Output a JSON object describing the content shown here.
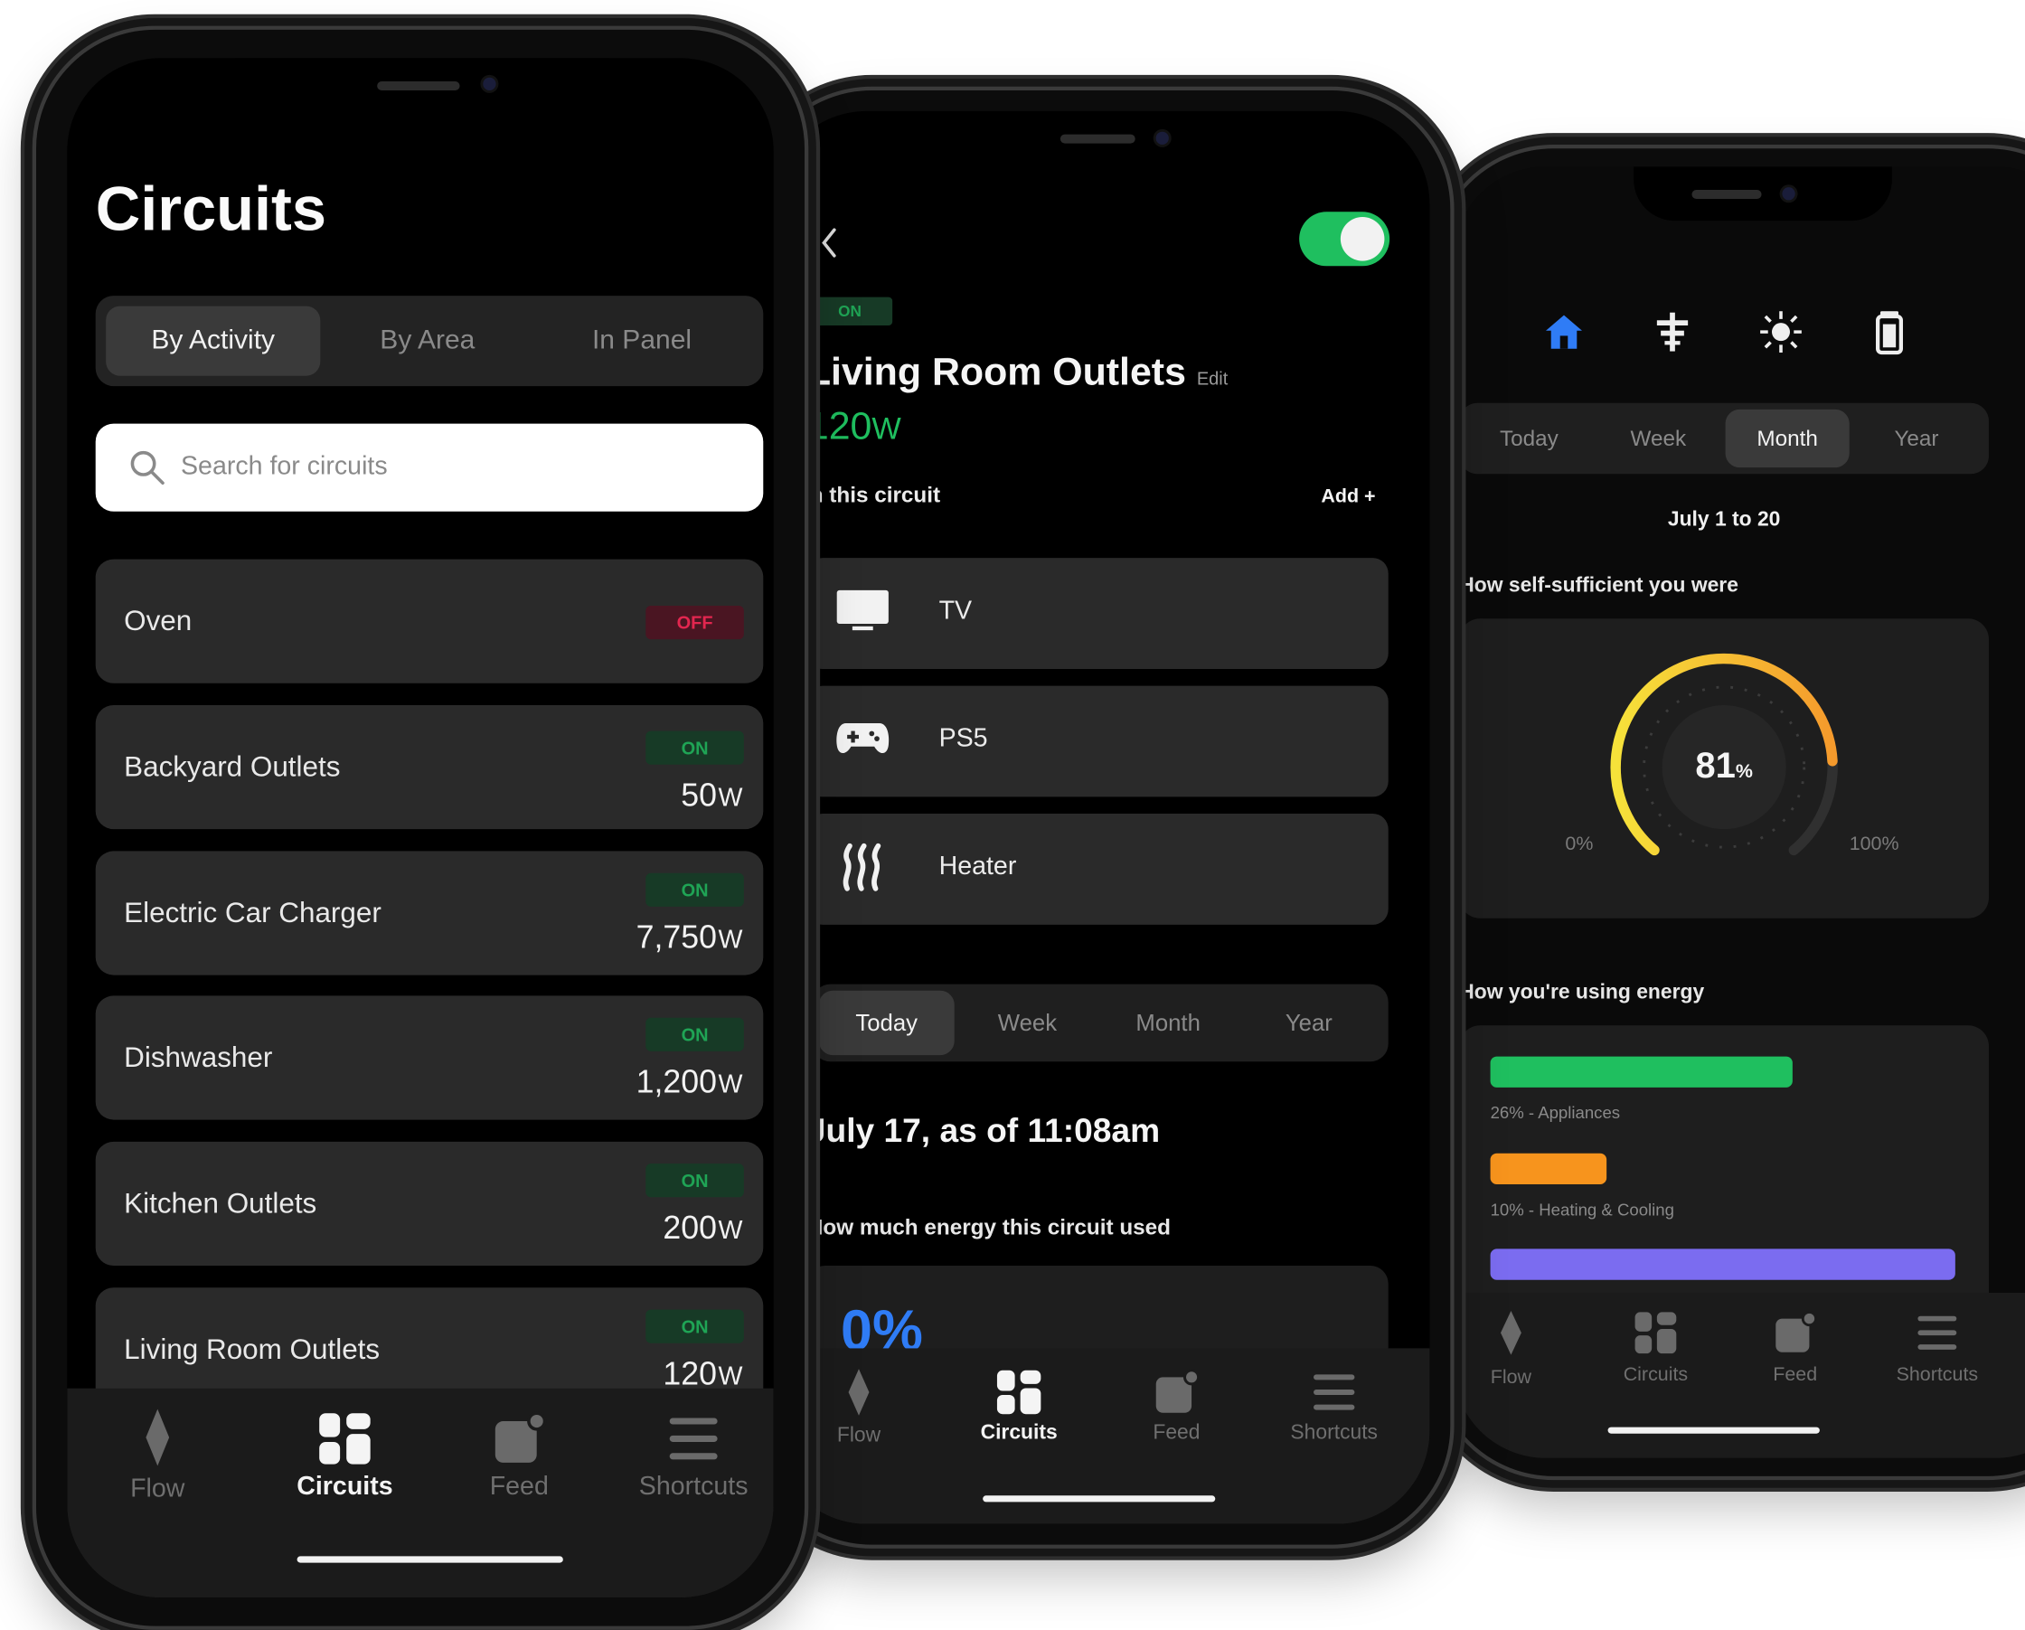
{
  "phone1": {
    "title": "Circuits",
    "segments": [
      "By Activity",
      "By Area",
      "In Panel"
    ],
    "search_placeholder": "Search for circuits",
    "circuits": [
      {
        "name": "Oven",
        "status": "OFF",
        "watts": "",
        "unit": ""
      },
      {
        "name": "Backyard Outlets",
        "status": "ON",
        "watts": "50",
        "unit": "W"
      },
      {
        "name": "Electric Car Charger",
        "status": "ON",
        "watts": "7,750",
        "unit": "W"
      },
      {
        "name": "Dishwasher",
        "status": "ON",
        "watts": "1,200",
        "unit": "W"
      },
      {
        "name": "Kitchen Outlets",
        "status": "ON",
        "watts": "200",
        "unit": "W"
      },
      {
        "name": "Living Room Outlets",
        "status": "ON",
        "watts": "120",
        "unit": "W"
      }
    ],
    "tabs": [
      "Flow",
      "Circuits",
      "Feed",
      "Shortcuts"
    ],
    "active_tab": "Circuits"
  },
  "phone2": {
    "status": "ON",
    "title": "Living Room Outlets",
    "edit_label": "Edit",
    "power_value": "120",
    "power_unit": "W",
    "section_label": "n this circuit",
    "add_label": "Add +",
    "devices": [
      {
        "name": "TV",
        "icon": "tv-icon"
      },
      {
        "name": "PS5",
        "icon": "gamepad-icon"
      },
      {
        "name": "Heater",
        "icon": "heater-icon"
      }
    ],
    "periods": [
      "Today",
      "Week",
      "Month",
      "Year"
    ],
    "active_period": "Today",
    "date_heading": "July 17, as of 11:08am",
    "usage_heading": "How much energy this circuit used",
    "partial_value": "0%",
    "tabs": [
      "Flow",
      "Circuits",
      "Feed",
      "Shortcuts"
    ],
    "active_tab": "Circuits"
  },
  "phone3": {
    "periods": [
      "Today",
      "Week",
      "Month",
      "Year"
    ],
    "active_period": "Month",
    "date_range": "July 1 to 20",
    "self_sufficient_heading": "How self-sufficient you were",
    "gauge": {
      "value": 81,
      "value_label": "81",
      "unit": "%",
      "min_label": "0%",
      "max_label": "100%"
    },
    "energy_heading": "How you're using energy",
    "usage_bars": [
      {
        "label": "26% - Appliances",
        "percent": 26,
        "color": "#1fbf5f"
      },
      {
        "label": "10% - Heating & Cooling",
        "percent": 10,
        "color": "#f7941d"
      },
      {
        "label": "",
        "percent": 40,
        "color": "#7b6cf0"
      }
    ],
    "tabs": [
      "Flow",
      "Circuits",
      "Feed",
      "Shortcuts"
    ],
    "colors": {
      "accent_blue": "#2f7cf6",
      "green": "#1fbf5f",
      "red": "#e2264f"
    }
  }
}
